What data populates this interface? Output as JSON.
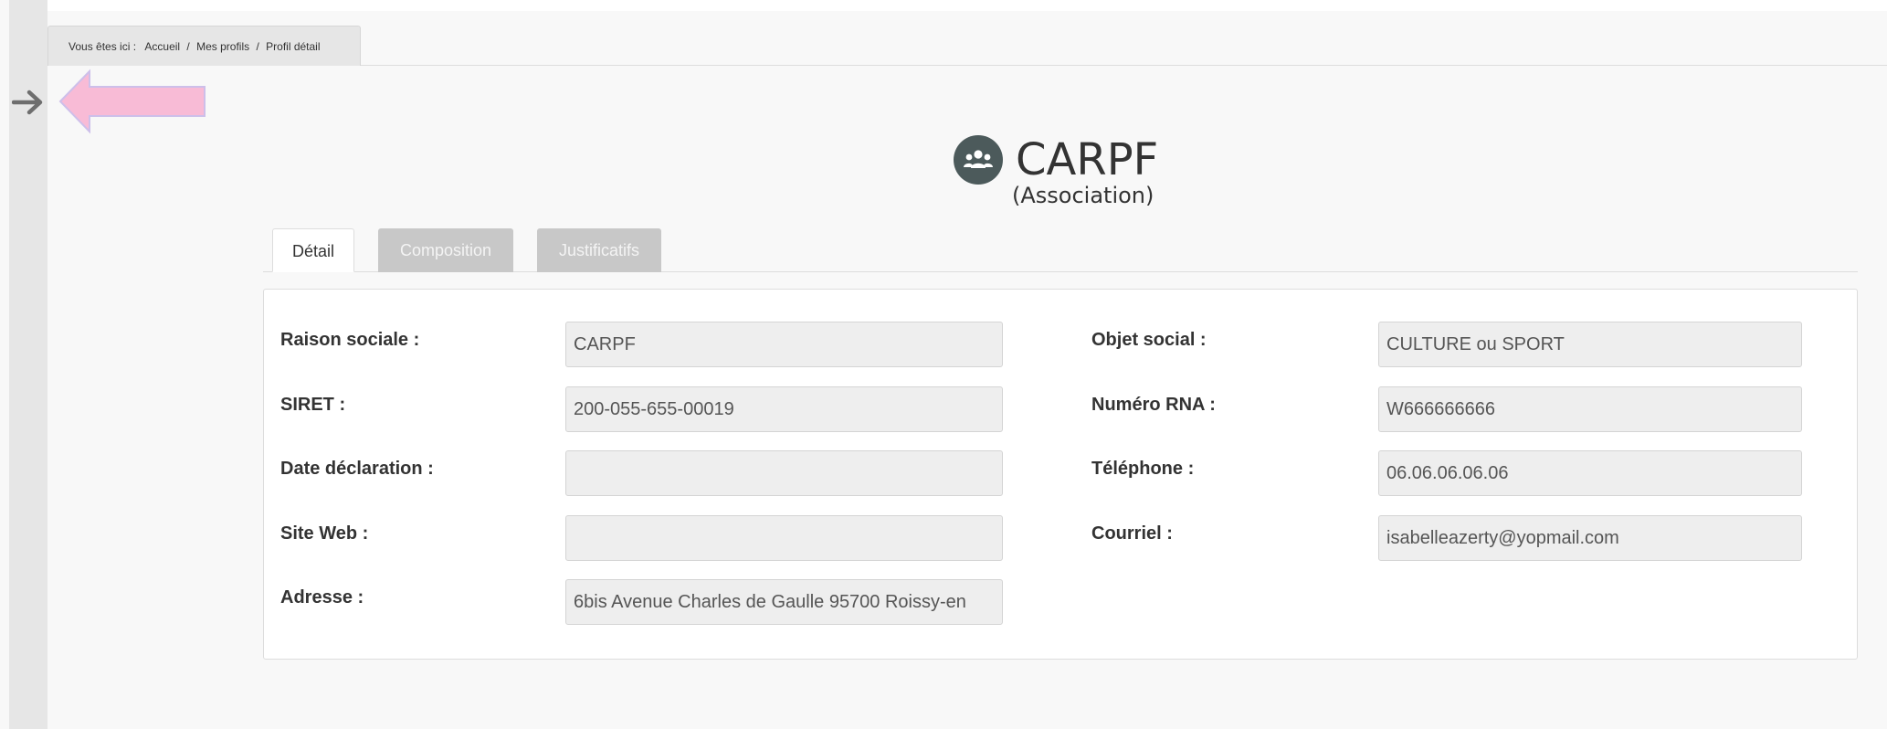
{
  "breadcrumb": {
    "prefix": "Vous êtes ici :",
    "items": [
      "Accueil",
      "Mes profils",
      "Profil détail"
    ],
    "separator": "/"
  },
  "header": {
    "title": "CARPF",
    "subtitle": "(Association)",
    "icon": "users-icon"
  },
  "tabs": [
    {
      "label": "Détail",
      "active": true
    },
    {
      "label": "Composition",
      "active": false
    },
    {
      "label": "Justificatifs",
      "active": false
    }
  ],
  "fields": {
    "raison_sociale": {
      "label": "Raison sociale :",
      "value": "CARPF"
    },
    "siret": {
      "label": "SIRET :",
      "value": "200-055-655-00019"
    },
    "date_declaration": {
      "label": "Date déclaration :",
      "value": ""
    },
    "site_web": {
      "label": "Site Web :",
      "value": ""
    },
    "adresse": {
      "label": "Adresse :",
      "value": "6bis Avenue Charles de Gaulle  95700 Roissy-en"
    },
    "objet_social": {
      "label": "Objet social :",
      "value": "CULTURE ou SPORT"
    },
    "numero_rna": {
      "label": "Numéro RNA :",
      "value": "W666666666"
    },
    "telephone": {
      "label": "Téléphone :",
      "value": "06.06.06.06.06"
    },
    "courriel": {
      "label": "Courriel :",
      "value": "isabelleazerty@yopmail.com"
    }
  },
  "colors": {
    "accent_pink": "#f8bbd6",
    "tab_inactive": "#c8c8c8",
    "title_icon": "#4c5a5b"
  }
}
